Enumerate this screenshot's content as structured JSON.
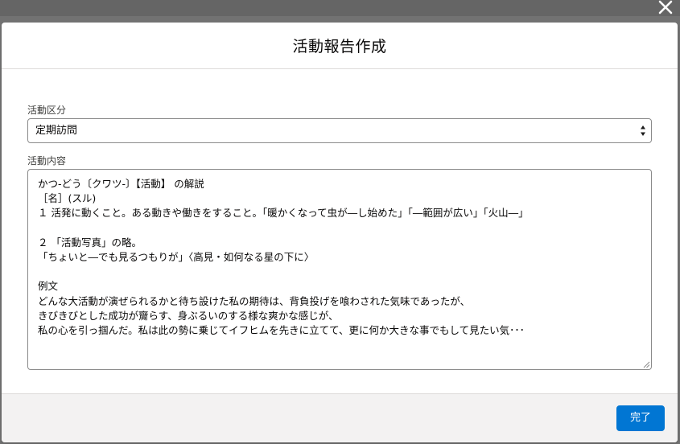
{
  "modal": {
    "title": "活動報告作成",
    "close_label": "×"
  },
  "form": {
    "category": {
      "label": "活動区分",
      "value": "定期訪問"
    },
    "content": {
      "label": "活動内容",
      "lines": [
        "かつ-どう〔クワツ-〕【活動】 の解説",
        "［名］(スル)",
        "１ 活発に動くこと。ある動きや働きをすること。「暖かくなって虫が―し始めた」「―範囲が広い」「火山―」",
        "",
        "２ 「活動写真」の略。",
        "「ちょいと―でも見るつもりが」〈高見・如何なる星の下に〉",
        "",
        "例文",
        "どんな大活動が演ぜられるかと待ち設けた私の期待は、背負投げを喰わされた気味であったが、",
        "きびきびとした成功が齎らす、身ぶるいのする様な爽かな感じが、",
        "私の心を引っ掴んだ。私は此の勢に乗じてイフヒムを先きに立てて、更に何か大きな事でもして見たい気･･･"
      ]
    }
  },
  "footer": {
    "done_label": "完了"
  },
  "colors": {
    "brand": "#0176d3",
    "overlay": "#080808",
    "footer_bg": "#f3f2f2"
  }
}
